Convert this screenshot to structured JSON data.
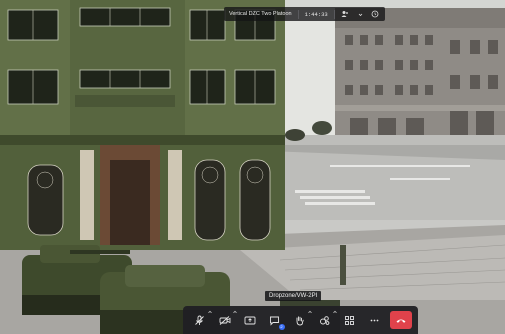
{
  "window": {
    "title": "Vertical DZC Two Platoon",
    "clock": "1:44:33"
  },
  "participant": {
    "name": "Dropzone/VW-2PI"
  },
  "toolbar": {
    "items": [
      {
        "icon": "mic-icon",
        "has_caret": true
      },
      {
        "icon": "camera-icon",
        "has_caret": true
      },
      {
        "icon": "share-screen-icon",
        "has_caret": false
      },
      {
        "icon": "chat-icon",
        "has_caret": false,
        "badge": "2"
      },
      {
        "icon": "raise-hand-icon",
        "has_caret": true
      },
      {
        "icon": "reactions-icon",
        "has_caret": true
      },
      {
        "icon": "apps-icon",
        "has_caret": false
      },
      {
        "icon": "more-icon",
        "has_caret": false
      },
      {
        "icon": "leave-call-icon",
        "has_caret": false
      }
    ]
  },
  "colors": {
    "toolbar_bg": "#202024",
    "leave": "#e0424b",
    "badge": "#3a6ff7"
  }
}
